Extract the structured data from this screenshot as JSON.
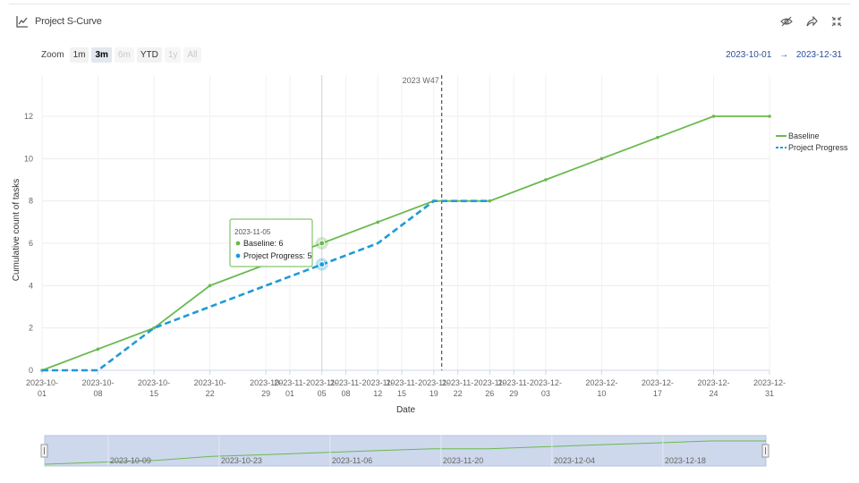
{
  "header": {
    "title": "Project S-Curve",
    "title_icon": "line-chart-icon",
    "actions": [
      "hide-icon",
      "share-icon",
      "collapse-icon"
    ]
  },
  "toolbar": {
    "zoom_label": "Zoom",
    "buttons": [
      {
        "label": "1m",
        "state": "enabled"
      },
      {
        "label": "3m",
        "state": "active"
      },
      {
        "label": "6m",
        "state": "disabled"
      },
      {
        "label": "YTD",
        "state": "enabled"
      },
      {
        "label": "1y",
        "state": "disabled"
      },
      {
        "label": "All",
        "state": "disabled"
      }
    ]
  },
  "range": {
    "from": "2023-10-01",
    "sep": "→",
    "to": "2023-12-31"
  },
  "colors": {
    "baseline": "#6ab94f",
    "progress": "#1e9bd6",
    "navigator_bg": "#cdd8ec",
    "range_text": "#2a4e9b"
  },
  "chart_data": {
    "type": "line",
    "xlabel": "Date",
    "ylabel": "Cumulative count of tasks",
    "ylim": [
      0,
      12
    ],
    "yticks": [
      "0",
      "2",
      "4",
      "6",
      "8",
      "10",
      "12"
    ],
    "x_ticks": [
      {
        "date": "2023-10-01",
        "label": [
          "2023-10-",
          "01"
        ]
      },
      {
        "date": "2023-10-08",
        "label": [
          "2023-10-",
          "08"
        ]
      },
      {
        "date": "2023-10-15",
        "label": [
          "2023-10-",
          "15"
        ]
      },
      {
        "date": "2023-10-22",
        "label": [
          "2023-10-",
          "22"
        ]
      },
      {
        "date": "2023-10-29",
        "label": [
          "2023-10-",
          "29"
        ]
      },
      {
        "date": "2023-11-01",
        "label": [
          "2023-11-",
          "01"
        ]
      },
      {
        "date": "2023-11-05",
        "label": [
          "2023-11-",
          "05"
        ]
      },
      {
        "date": "2023-11-08",
        "label": [
          "2023-11-",
          "08"
        ]
      },
      {
        "date": "2023-11-12",
        "label": [
          "2023-11-",
          "12"
        ]
      },
      {
        "date": "2023-11-15",
        "label": [
          "2023-11-",
          "15"
        ]
      },
      {
        "date": "2023-11-19",
        "label": [
          "2023-11-",
          "19"
        ]
      },
      {
        "date": "2023-11-22",
        "label": [
          "2023-11-",
          "22"
        ]
      },
      {
        "date": "2023-11-26",
        "label": [
          "2023-11-",
          "26"
        ]
      },
      {
        "date": "2023-11-29",
        "label": [
          "2023-11-",
          "29"
        ]
      },
      {
        "date": "2023-12-03",
        "label": [
          "2023-12-",
          "03"
        ]
      },
      {
        "date": "2023-12-10",
        "label": [
          "2023-12-",
          "10"
        ]
      },
      {
        "date": "2023-12-17",
        "label": [
          "2023-12-",
          "17"
        ]
      },
      {
        "date": "2023-12-24",
        "label": [
          "2023-12-",
          "24"
        ]
      },
      {
        "date": "2023-12-31",
        "label": [
          "2023-12-",
          "31"
        ]
      }
    ],
    "x_start": "2023-10-01",
    "x_end": "2023-12-31",
    "series": [
      {
        "name": "Baseline",
        "style": "solid",
        "points": [
          {
            "date": "2023-10-01",
            "y": 0
          },
          {
            "date": "2023-10-08",
            "y": 1
          },
          {
            "date": "2023-10-15",
            "y": 2
          },
          {
            "date": "2023-10-22",
            "y": 4
          },
          {
            "date": "2023-10-29",
            "y": 5
          },
          {
            "date": "2023-11-05",
            "y": 6
          },
          {
            "date": "2023-11-12",
            "y": 7
          },
          {
            "date": "2023-11-19",
            "y": 8
          },
          {
            "date": "2023-11-26",
            "y": 8
          },
          {
            "date": "2023-12-03",
            "y": 9
          },
          {
            "date": "2023-12-10",
            "y": 10
          },
          {
            "date": "2023-12-17",
            "y": 11
          },
          {
            "date": "2023-12-24",
            "y": 12
          },
          {
            "date": "2023-12-31",
            "y": 12
          }
        ]
      },
      {
        "name": "Project Progress",
        "style": "dashed",
        "points": [
          {
            "date": "2023-10-01",
            "y": 0
          },
          {
            "date": "2023-10-08",
            "y": 0
          },
          {
            "date": "2023-10-15",
            "y": 2
          },
          {
            "date": "2023-10-22",
            "y": 3
          },
          {
            "date": "2023-10-29",
            "y": 4
          },
          {
            "date": "2023-11-05",
            "y": 5
          },
          {
            "date": "2023-11-12",
            "y": 6
          },
          {
            "date": "2023-11-19",
            "y": 8
          },
          {
            "date": "2023-11-26",
            "y": 8
          }
        ]
      }
    ],
    "plot_band_line": {
      "date": "2023-11-20",
      "label": "2023 W47"
    },
    "crosshair_date": "2023-11-05",
    "tooltip": {
      "date": "2023-11-05",
      "rows": [
        {
          "series": "Baseline",
          "value": 6
        },
        {
          "series": "Project Progress",
          "value": 5
        }
      ]
    },
    "legend_position": "right",
    "navigator_labels": [
      "2023-10-09",
      "2023-10-23",
      "2023-11-06",
      "2023-11-20",
      "2023-12-04",
      "2023-12-18"
    ]
  }
}
